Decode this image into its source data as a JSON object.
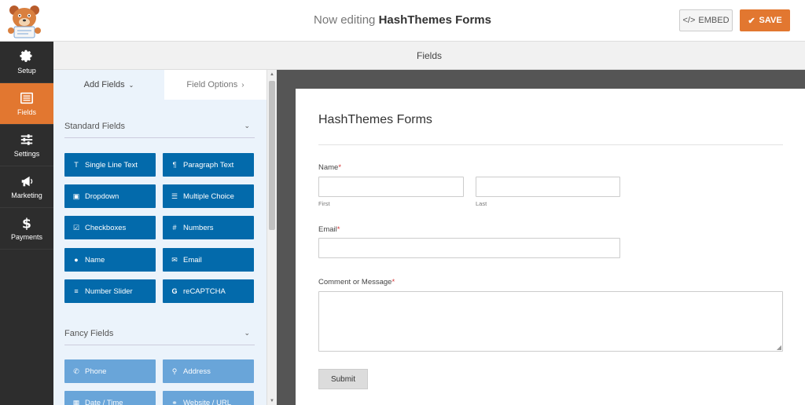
{
  "header": {
    "title_prefix": "Now editing",
    "title_form": "HashThemes Forms",
    "embed_label": "EMBED",
    "save_label": "SAVE"
  },
  "nav": {
    "items": [
      {
        "label": "Setup",
        "icon": "gear-icon"
      },
      {
        "label": "Fields",
        "icon": "list-icon"
      },
      {
        "label": "Settings",
        "icon": "sliders-icon"
      },
      {
        "label": "Marketing",
        "icon": "megaphone-icon"
      },
      {
        "label": "Payments",
        "icon": "dollar-icon"
      }
    ]
  },
  "fields_bar": {
    "title": "Fields"
  },
  "panel": {
    "tabs": [
      {
        "label": "Add Fields"
      },
      {
        "label": "Field Options"
      }
    ],
    "standard": {
      "title": "Standard Fields",
      "buttons": [
        "Single Line Text",
        "Paragraph Text",
        "Dropdown",
        "Multiple Choice",
        "Checkboxes",
        "Numbers",
        "Name",
        "Email",
        "Number Slider",
        "reCAPTCHA"
      ]
    },
    "fancy": {
      "title": "Fancy Fields",
      "buttons": [
        "Phone",
        "Address",
        "Date / Time",
        "Website / URL"
      ]
    }
  },
  "form": {
    "title": "HashThemes Forms",
    "name_label": "Name",
    "first_label": "First",
    "last_label": "Last",
    "email_label": "Email",
    "message_label": "Comment or Message",
    "required_mark": "*",
    "submit_label": "Submit"
  },
  "colors": {
    "accent": "#e27730",
    "field_button": "#036aab",
    "nav_bg": "#2d2d2d"
  }
}
